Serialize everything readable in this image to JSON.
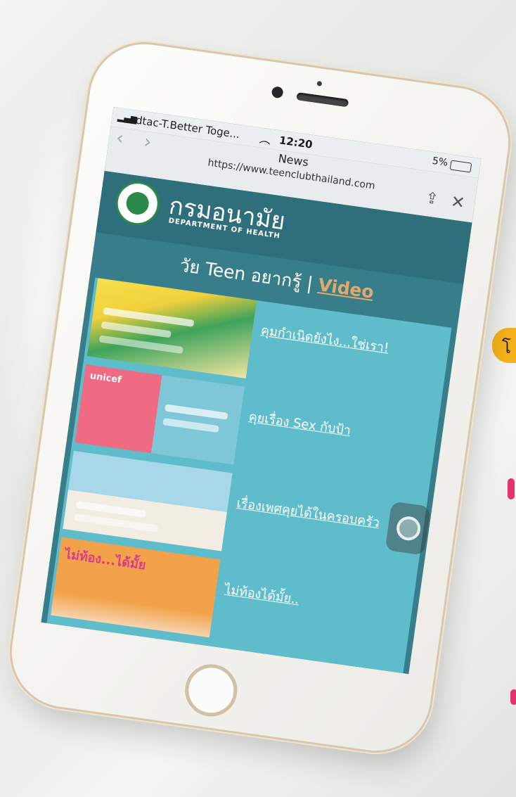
{
  "status_bar": {
    "carrier": "dtac-T.Better Toge...",
    "time": "12:20",
    "battery": "5%"
  },
  "browser": {
    "page_title": "News",
    "url": "https://www.teenclubthailand.com"
  },
  "site_header": {
    "org_name_thai": "กรมอนามัย",
    "org_name_en": "DEPARTMENT OF HEALTH"
  },
  "page": {
    "heading": "วัย Teen อยากรู้ |",
    "heading_link": "Video"
  },
  "videos": [
    {
      "title": "คุมกำเนิดยังไง...ใช่เรา!",
      "thumb_badge": "",
      "thumb_color": "#f2d13b"
    },
    {
      "title": "คุยเรื่อง Sex กับป้า",
      "thumb_badge": "unicef",
      "thumb_color": "#ee6b83"
    },
    {
      "title": "เรื่องเพศคุยได้ในครอบครัว",
      "thumb_badge": "",
      "thumb_color": "#a8d7ea"
    },
    {
      "title": "ไม่ท้องได้มั้ย..",
      "thumb_badge": "ไม่ท้อง...ได้มั้ย",
      "thumb_color": "#f2a24a"
    }
  ],
  "colors": {
    "header_bg": "#2f6f7b",
    "panel_bg": "#5fbdcb",
    "accent_link": "#e5a86b"
  }
}
